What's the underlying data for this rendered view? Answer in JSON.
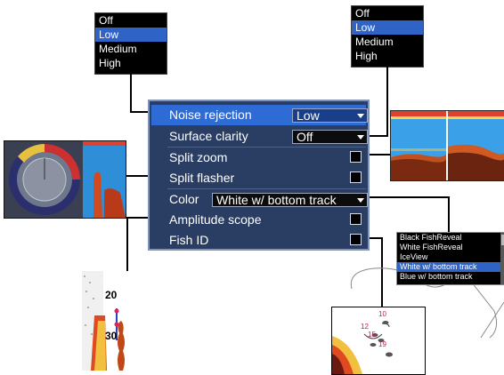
{
  "top_left_popup": {
    "options": [
      "Off",
      "Low",
      "Medium",
      "High"
    ],
    "selected": 1
  },
  "top_right_popup": {
    "options": [
      "Off",
      "Low",
      "Medium",
      "High"
    ],
    "selected": 1
  },
  "menu": {
    "rows": [
      {
        "label": "Noise rejection",
        "control": "dropdown",
        "value": "Low",
        "selected": true
      },
      {
        "label": "Surface clarity",
        "control": "dropdown",
        "value": "Off",
        "selected": false
      },
      {
        "label": "Split zoom",
        "control": "checkbox",
        "checked": false,
        "selected": false
      },
      {
        "label": "Split flasher",
        "control": "checkbox",
        "checked": false,
        "selected": false
      },
      {
        "label": "Color",
        "control": "dropdown",
        "value": "White w/ bottom track",
        "selected": false
      },
      {
        "label": "Amplitude scope",
        "control": "checkbox",
        "checked": false,
        "selected": false
      },
      {
        "label": "Fish ID",
        "control": "checkbox",
        "checked": false,
        "selected": false
      }
    ]
  },
  "color_list": {
    "options": [
      "Black FishReveal",
      "White FishReveal",
      "IceView",
      "White w/ bottom track",
      "Blue w/ bottom track"
    ],
    "selected": 3
  },
  "amplitude_scope_preview": {
    "depth_labels": [
      "20",
      "30"
    ]
  },
  "fish_id_preview": {
    "depth_labels": [
      "10",
      "12",
      "15",
      "19"
    ]
  },
  "colors": {
    "menu_bg": "#2a3d62",
    "selected_row": "#2e6bd4",
    "popup_selected": "#2f64c6"
  }
}
